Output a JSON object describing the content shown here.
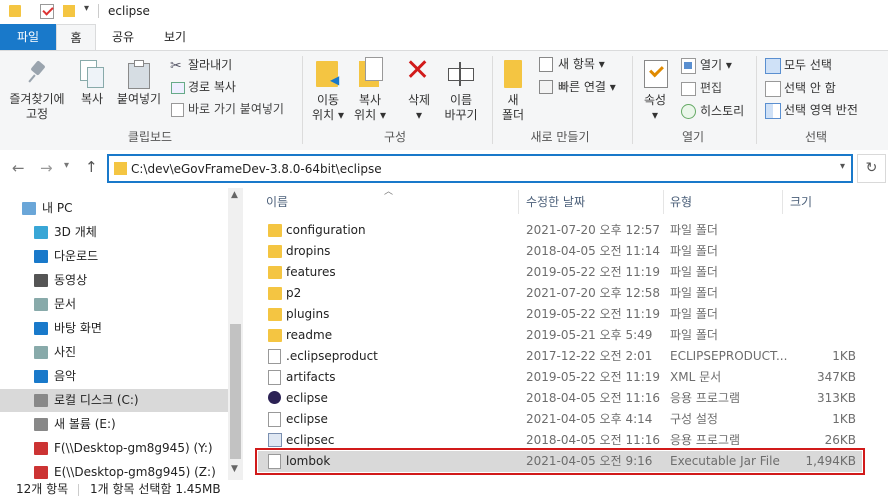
{
  "window": {
    "title": "eclipse"
  },
  "tabs": [
    {
      "label": "파일"
    },
    {
      "label": "홈"
    },
    {
      "label": "공유"
    },
    {
      "label": "보기"
    }
  ],
  "ribbon": {
    "clipboard": {
      "pin_line1": "즐겨찾기에",
      "pin_line2": "고정",
      "copy": "복사",
      "paste": "붙여넣기",
      "cut": "잘라내기",
      "copy_path": "경로 복사",
      "paste_shortcut": "바로 가기 붙여넣기",
      "group": "클립보드"
    },
    "organize": {
      "move_line1": "이동",
      "move_line2": "위치",
      "copyto_line1": "복사",
      "copyto_line2": "위치",
      "delete": "삭제",
      "rename_line1": "이름",
      "rename_line2": "바꾸기",
      "group": "구성"
    },
    "new": {
      "folder_line1": "새",
      "folder_line2": "폴더",
      "new_item": "새 항목",
      "easy_access": "빠른 연결",
      "group": "새로 만들기"
    },
    "open": {
      "properties": "속성",
      "open": "열기",
      "edit": "편집",
      "history": "히스토리",
      "group": "열기"
    },
    "select": {
      "select_all": "모두 선택",
      "select_none": "선택 안 함",
      "invert": "선택 영역 반전",
      "group": "선택"
    }
  },
  "address": {
    "path": "C:\\dev\\eGovFrameDev-3.8.0-64bit\\eclipse"
  },
  "nav": [
    {
      "label": "내 PC"
    },
    {
      "label": "3D 개체"
    },
    {
      "label": "다운로드"
    },
    {
      "label": "동영상"
    },
    {
      "label": "문서"
    },
    {
      "label": "바탕 화면"
    },
    {
      "label": "사진"
    },
    {
      "label": "음악"
    },
    {
      "label": "로컬 디스크 (C:)"
    },
    {
      "label": "새 볼륨 (E:)"
    },
    {
      "label": "F(\\\\Desktop-gm8g945) (Y:)"
    },
    {
      "label": "E(\\\\Desktop-gm8g945) (Z:)"
    }
  ],
  "columns": {
    "name": "이름",
    "date": "수정한 날짜",
    "type": "유형",
    "size": "크기"
  },
  "files": [
    {
      "name": "configuration",
      "date": "2021-07-20 오후 12:57",
      "type": "파일 폴더",
      "size": "",
      "icon": "folder-icon"
    },
    {
      "name": "dropins",
      "date": "2018-04-05 오전 11:14",
      "type": "파일 폴더",
      "size": "",
      "icon": "folder-icon"
    },
    {
      "name": "features",
      "date": "2019-05-22 오전 11:19",
      "type": "파일 폴더",
      "size": "",
      "icon": "folder-icon"
    },
    {
      "name": "p2",
      "date": "2021-07-20 오후 12:58",
      "type": "파일 폴더",
      "size": "",
      "icon": "folder-icon"
    },
    {
      "name": "plugins",
      "date": "2019-05-22 오전 11:19",
      "type": "파일 폴더",
      "size": "",
      "icon": "folder-icon"
    },
    {
      "name": "readme",
      "date": "2019-05-21 오후 5:49",
      "type": "파일 폴더",
      "size": "",
      "icon": "folder-icon"
    },
    {
      "name": ".eclipseproduct",
      "date": "2017-12-22 오전 2:01",
      "type": "ECLIPSEPRODUCT...",
      "size": "1KB",
      "icon": "file-icon"
    },
    {
      "name": "artifacts",
      "date": "2019-05-22 오전 11:19",
      "type": "XML 문서",
      "size": "347KB",
      "icon": "xml-icon"
    },
    {
      "name": "eclipse",
      "date": "2018-04-05 오전 11:16",
      "type": "응용 프로그램",
      "size": "313KB",
      "icon": "eclipse-icon"
    },
    {
      "name": "eclipse",
      "date": "2021-04-05 오후 4:14",
      "type": "구성 설정",
      "size": "1KB",
      "icon": "settings-file-icon"
    },
    {
      "name": "eclipsec",
      "date": "2018-04-05 오전 11:16",
      "type": "응용 프로그램",
      "size": "26KB",
      "icon": "app-icon"
    },
    {
      "name": "lombok",
      "date": "2021-04-05 오전 9:16",
      "type": "Executable Jar File",
      "size": "1,494KB",
      "icon": "jar-icon"
    }
  ],
  "status": {
    "count": "12개 항목",
    "selection": "1개 항목 선택함 1.45MB"
  },
  "colors": {
    "accent": "#1979ca",
    "highlight": "#d11a1a",
    "folder": "#f4c542"
  }
}
